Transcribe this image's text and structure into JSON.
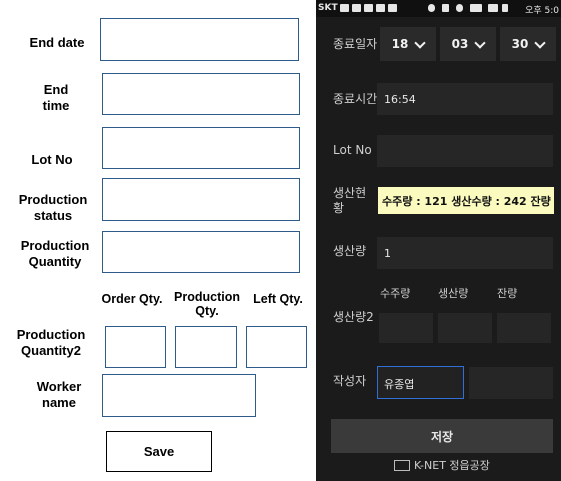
{
  "mockup": {
    "labels": {
      "end_date": "End date",
      "end_time": "End time",
      "lot_no": "Lot No",
      "production_status": "Production status",
      "production_quantity": "Production Quantity",
      "production_quantity2": "Production Quantity2",
      "worker_name": "Worker name"
    },
    "qty_headers": {
      "order": "Order Qty.",
      "production": "Production Qty.",
      "left": "Left Qty."
    },
    "save_label": "Save"
  },
  "phone": {
    "status_bar": {
      "carrier": "SKT",
      "time": "오후 5:0"
    },
    "labels": {
      "end_date": "종료일자",
      "end_time": "종료시간",
      "lot_no": "Lot No",
      "production_status": "생산현황",
      "production_qty": "생산량",
      "production_qty2": "생산량2",
      "author": "작성자"
    },
    "date": {
      "year": "18",
      "month": "03",
      "day": "30"
    },
    "end_time_value": "16:54",
    "status_value": "수주량 : 121  생산수량 : 242  잔량 :",
    "production_qty_value": "1",
    "qty2_headers": {
      "order": "수주량",
      "production": "생산량",
      "left": "잔량"
    },
    "author_value": "유종엽",
    "save_label": "저장",
    "footer_text": "K-NET 정읍공장",
    "colors": {
      "background": "#1b1b1b",
      "status_highlight": "#fbfbbf",
      "focus_border": "#2f6fd6"
    }
  }
}
